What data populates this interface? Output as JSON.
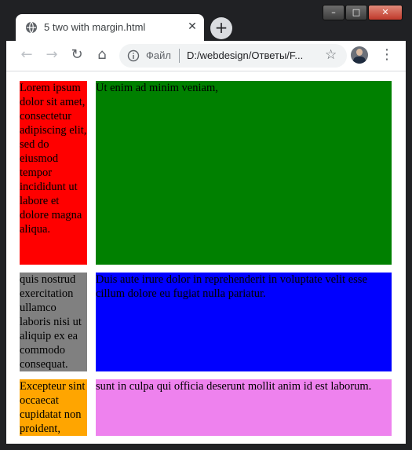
{
  "browser": {
    "tab": {
      "title": "5 two with margin.html",
      "close_glyph": "✕"
    },
    "new_tab_glyph": "+",
    "window_controls": {
      "minimize_glyph": "–",
      "maximize_glyph": "□",
      "close_glyph": "✕"
    },
    "toolbar": {
      "back_glyph": "←",
      "forward_glyph": "→",
      "reload_glyph": "↻",
      "home_glyph": "⌂",
      "menu_glyph": "⋮"
    },
    "omnibox": {
      "scheme_label": "Файл",
      "url": "D:/webdesign/Ответы/F...",
      "star_glyph": "☆"
    }
  },
  "page": {
    "cells": [
      {
        "text": "Lorem ipsum dolor sit amet, consectetur adipiscing elit, sed do eiusmod tempor incididunt ut labore et dolore magna aliqua.",
        "bg": "#ff0000"
      },
      {
        "text": "Ut enim ad minim veniam,",
        "bg": "#008000"
      },
      {
        "text": "quis nostrud exercitation ullamco laboris nisi ut aliquip ex ea commodo consequat.",
        "bg": "#808080"
      },
      {
        "text": "Duis aute irure dolor in reprehenderit in voluptate velit esse cillum dolore eu fugiat nulla pariatur.",
        "bg": "#0000ff"
      },
      {
        "text": "Excepteur sint occaecat cupidatat non proident,",
        "bg": "#ffa500"
      },
      {
        "text": "sunt in culpa qui officia deserunt mollit anim id est laborum.",
        "bg": "#ee82ee"
      }
    ]
  },
  "icons": {
    "tab_favicon": "globe-icon",
    "omnibox_info": "info-icon",
    "profile": "avatar-icon"
  }
}
